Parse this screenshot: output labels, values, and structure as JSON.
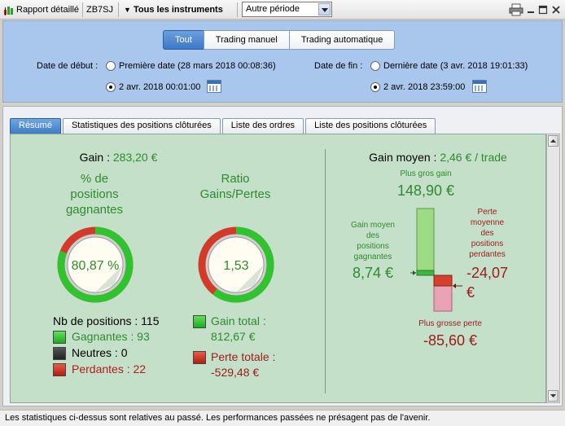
{
  "toolbar": {
    "report_label": "Rapport détaillé",
    "account": "ZB7SJ",
    "instruments_label": "Tous les instruments",
    "period_value": "Autre période"
  },
  "filters": {
    "segments": [
      "Tout",
      "Trading manuel",
      "Trading automatique"
    ],
    "active_segment": "Tout",
    "start_label": "Date de début :",
    "start_option_first": "Première date (28 mars 2018 00:08:36)",
    "start_option_custom": "2 avr. 2018 00:01:00",
    "end_label": "Date de fin :",
    "end_option_last": "Dernière date (3 avr. 2018 19:01:33)",
    "end_option_custom": "2 avr. 2018 23:59:00"
  },
  "tabs": [
    "Résumé",
    "Statistiques des positions clôturées",
    "Liste des ordres",
    "Liste des positions clôturées"
  ],
  "active_tab": "Résumé",
  "summary": {
    "gain_label": "Gain :",
    "gain_value": "283,20 €",
    "win_pct_title_1": "% de",
    "win_pct_title_2": "positions",
    "win_pct_title_3": "gagnantes",
    "win_pct_value": "80,87 %",
    "win_fraction": 0.8087,
    "ratio_title_1": "Ratio",
    "ratio_title_2": "Gains/Pertes",
    "ratio_value": "1,53",
    "positions_label": "Nb de positions : 115",
    "winners_label": "Gagnantes : 93",
    "neutral_label": "Neutres : 0",
    "losers_label": "Perdantes : 22",
    "gain_total_label": "Gain total :",
    "gain_total_value": "812,67 €",
    "loss_total_label": "Perte totale :",
    "loss_total_value": "-529,48 €"
  },
  "average": {
    "title_label": "Gain moyen :",
    "title_value": "2,46 € / trade",
    "biggest_gain_label": "Plus gros gain",
    "biggest_gain_value": "148,90 €",
    "avg_gain_label_1": "Gain moyen",
    "avg_gain_label_2": "des",
    "avg_gain_label_3": "positions",
    "avg_gain_label_4": "gagnantes",
    "avg_gain_value": "8,74 €",
    "avg_loss_label_1": "Perte",
    "avg_loss_label_2": "moyenne",
    "avg_loss_label_3": "des",
    "avg_loss_label_4": "positions",
    "avg_loss_label_5": "perdantes",
    "avg_loss_value_1": "-24,07",
    "avg_loss_value_2": "€",
    "biggest_loss_label": "Plus grosse perte",
    "biggest_loss_value": "-85,60 €"
  },
  "footer": "Les statistiques ci-dessus sont relatives au passé. Les performances passées ne présagent pas de l'avenir.",
  "colors": {
    "panel_bg": "#c4e0c8",
    "gain_green": "#2e8b2e",
    "loss_red": "#b01c1c",
    "ring_green": "#2fc42f",
    "ring_red": "#d43a2a",
    "accent_blue": "#3c78c4"
  },
  "icons": [
    "chart-icon",
    "dropdown-arrow-icon",
    "printer-icon",
    "minimize-icon",
    "restore-icon",
    "close-icon",
    "calendar-icon"
  ]
}
